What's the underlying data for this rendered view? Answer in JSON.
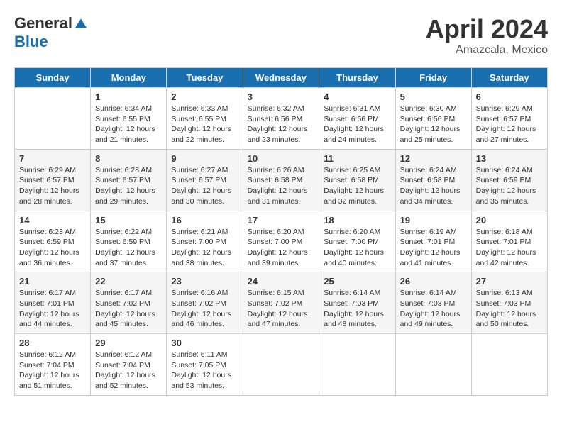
{
  "header": {
    "logo": {
      "general": "General",
      "blue": "Blue"
    },
    "title": "April 2024",
    "location": "Amazcala, Mexico"
  },
  "columns": [
    "Sunday",
    "Monday",
    "Tuesday",
    "Wednesday",
    "Thursday",
    "Friday",
    "Saturday"
  ],
  "weeks": [
    [
      {
        "day": "",
        "sunrise": "",
        "sunset": "",
        "daylight": ""
      },
      {
        "day": "1",
        "sunrise": "Sunrise: 6:34 AM",
        "sunset": "Sunset: 6:55 PM",
        "daylight": "Daylight: 12 hours and 21 minutes."
      },
      {
        "day": "2",
        "sunrise": "Sunrise: 6:33 AM",
        "sunset": "Sunset: 6:55 PM",
        "daylight": "Daylight: 12 hours and 22 minutes."
      },
      {
        "day": "3",
        "sunrise": "Sunrise: 6:32 AM",
        "sunset": "Sunset: 6:56 PM",
        "daylight": "Daylight: 12 hours and 23 minutes."
      },
      {
        "day": "4",
        "sunrise": "Sunrise: 6:31 AM",
        "sunset": "Sunset: 6:56 PM",
        "daylight": "Daylight: 12 hours and 24 minutes."
      },
      {
        "day": "5",
        "sunrise": "Sunrise: 6:30 AM",
        "sunset": "Sunset: 6:56 PM",
        "daylight": "Daylight: 12 hours and 25 minutes."
      },
      {
        "day": "6",
        "sunrise": "Sunrise: 6:29 AM",
        "sunset": "Sunset: 6:57 PM",
        "daylight": "Daylight: 12 hours and 27 minutes."
      }
    ],
    [
      {
        "day": "7",
        "sunrise": "Sunrise: 6:29 AM",
        "sunset": "Sunset: 6:57 PM",
        "daylight": "Daylight: 12 hours and 28 minutes."
      },
      {
        "day": "8",
        "sunrise": "Sunrise: 6:28 AM",
        "sunset": "Sunset: 6:57 PM",
        "daylight": "Daylight: 12 hours and 29 minutes."
      },
      {
        "day": "9",
        "sunrise": "Sunrise: 6:27 AM",
        "sunset": "Sunset: 6:57 PM",
        "daylight": "Daylight: 12 hours and 30 minutes."
      },
      {
        "day": "10",
        "sunrise": "Sunrise: 6:26 AM",
        "sunset": "Sunset: 6:58 PM",
        "daylight": "Daylight: 12 hours and 31 minutes."
      },
      {
        "day": "11",
        "sunrise": "Sunrise: 6:25 AM",
        "sunset": "Sunset: 6:58 PM",
        "daylight": "Daylight: 12 hours and 32 minutes."
      },
      {
        "day": "12",
        "sunrise": "Sunrise: 6:24 AM",
        "sunset": "Sunset: 6:58 PM",
        "daylight": "Daylight: 12 hours and 34 minutes."
      },
      {
        "day": "13",
        "sunrise": "Sunrise: 6:24 AM",
        "sunset": "Sunset: 6:59 PM",
        "daylight": "Daylight: 12 hours and 35 minutes."
      }
    ],
    [
      {
        "day": "14",
        "sunrise": "Sunrise: 6:23 AM",
        "sunset": "Sunset: 6:59 PM",
        "daylight": "Daylight: 12 hours and 36 minutes."
      },
      {
        "day": "15",
        "sunrise": "Sunrise: 6:22 AM",
        "sunset": "Sunset: 6:59 PM",
        "daylight": "Daylight: 12 hours and 37 minutes."
      },
      {
        "day": "16",
        "sunrise": "Sunrise: 6:21 AM",
        "sunset": "Sunset: 7:00 PM",
        "daylight": "Daylight: 12 hours and 38 minutes."
      },
      {
        "day": "17",
        "sunrise": "Sunrise: 6:20 AM",
        "sunset": "Sunset: 7:00 PM",
        "daylight": "Daylight: 12 hours and 39 minutes."
      },
      {
        "day": "18",
        "sunrise": "Sunrise: 6:20 AM",
        "sunset": "Sunset: 7:00 PM",
        "daylight": "Daylight: 12 hours and 40 minutes."
      },
      {
        "day": "19",
        "sunrise": "Sunrise: 6:19 AM",
        "sunset": "Sunset: 7:01 PM",
        "daylight": "Daylight: 12 hours and 41 minutes."
      },
      {
        "day": "20",
        "sunrise": "Sunrise: 6:18 AM",
        "sunset": "Sunset: 7:01 PM",
        "daylight": "Daylight: 12 hours and 42 minutes."
      }
    ],
    [
      {
        "day": "21",
        "sunrise": "Sunrise: 6:17 AM",
        "sunset": "Sunset: 7:01 PM",
        "daylight": "Daylight: 12 hours and 44 minutes."
      },
      {
        "day": "22",
        "sunrise": "Sunrise: 6:17 AM",
        "sunset": "Sunset: 7:02 PM",
        "daylight": "Daylight: 12 hours and 45 minutes."
      },
      {
        "day": "23",
        "sunrise": "Sunrise: 6:16 AM",
        "sunset": "Sunset: 7:02 PM",
        "daylight": "Daylight: 12 hours and 46 minutes."
      },
      {
        "day": "24",
        "sunrise": "Sunrise: 6:15 AM",
        "sunset": "Sunset: 7:02 PM",
        "daylight": "Daylight: 12 hours and 47 minutes."
      },
      {
        "day": "25",
        "sunrise": "Sunrise: 6:14 AM",
        "sunset": "Sunset: 7:03 PM",
        "daylight": "Daylight: 12 hours and 48 minutes."
      },
      {
        "day": "26",
        "sunrise": "Sunrise: 6:14 AM",
        "sunset": "Sunset: 7:03 PM",
        "daylight": "Daylight: 12 hours and 49 minutes."
      },
      {
        "day": "27",
        "sunrise": "Sunrise: 6:13 AM",
        "sunset": "Sunset: 7:03 PM",
        "daylight": "Daylight: 12 hours and 50 minutes."
      }
    ],
    [
      {
        "day": "28",
        "sunrise": "Sunrise: 6:12 AM",
        "sunset": "Sunset: 7:04 PM",
        "daylight": "Daylight: 12 hours and 51 minutes."
      },
      {
        "day": "29",
        "sunrise": "Sunrise: 6:12 AM",
        "sunset": "Sunset: 7:04 PM",
        "daylight": "Daylight: 12 hours and 52 minutes."
      },
      {
        "day": "30",
        "sunrise": "Sunrise: 6:11 AM",
        "sunset": "Sunset: 7:05 PM",
        "daylight": "Daylight: 12 hours and 53 minutes."
      },
      {
        "day": "",
        "sunrise": "",
        "sunset": "",
        "daylight": ""
      },
      {
        "day": "",
        "sunrise": "",
        "sunset": "",
        "daylight": ""
      },
      {
        "day": "",
        "sunrise": "",
        "sunset": "",
        "daylight": ""
      },
      {
        "day": "",
        "sunrise": "",
        "sunset": "",
        "daylight": ""
      }
    ]
  ]
}
